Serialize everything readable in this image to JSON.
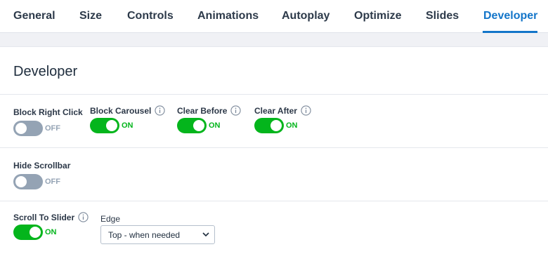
{
  "tabs": [
    {
      "label": "General"
    },
    {
      "label": "Size"
    },
    {
      "label": "Controls"
    },
    {
      "label": "Animations"
    },
    {
      "label": "Autoplay"
    },
    {
      "label": "Optimize"
    },
    {
      "label": "Slides"
    },
    {
      "label": "Developer",
      "active": true
    }
  ],
  "colors": {
    "accent": "#1375c9",
    "on": "#04b51c",
    "off": "#94a3b4"
  },
  "panel": {
    "title": "Developer",
    "fields": {
      "block_right_click": {
        "label": "Block Right Click",
        "state": "OFF"
      },
      "block_carousel": {
        "label": "Block Carousel",
        "icon": "info-icon",
        "state": "ON"
      },
      "clear_before": {
        "label": "Clear Before",
        "icon": "info-icon",
        "state": "ON"
      },
      "clear_after": {
        "label": "Clear After",
        "icon": "info-icon",
        "state": "ON"
      },
      "hide_scrollbar": {
        "label": "Hide Scrollbar",
        "state": "OFF"
      },
      "scroll_to_slider": {
        "label": "Scroll To Slider",
        "icon": "info-icon",
        "state": "ON"
      },
      "edge": {
        "label": "Edge",
        "value": "Top - when needed",
        "icon": "chevron-down-icon"
      }
    }
  }
}
